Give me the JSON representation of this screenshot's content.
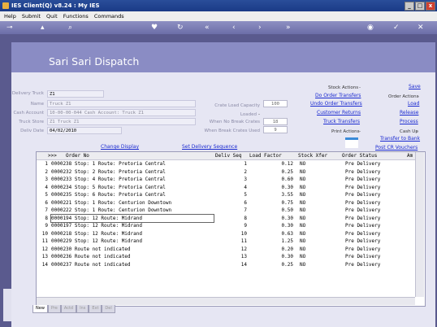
{
  "window": {
    "title": "IES Client(Q) v8.24 : My IES",
    "controls": [
      "_",
      "□",
      "x"
    ]
  },
  "menu": [
    "Help",
    "Submit",
    "Quit",
    "Functions",
    "Commands"
  ],
  "toolbar": {
    "icons": [
      "key-icon",
      "lock-icon",
      "search-icon",
      "heart-icon",
      "refresh-icon",
      "first-icon",
      "prev-icon",
      "next-icon",
      "last-icon",
      "stop-icon",
      "ok-icon",
      "cancel-icon"
    ]
  },
  "page": {
    "title": "Sari Sari Dispatch"
  },
  "form": {
    "delivery_truck": {
      "label": "Delivery Truck",
      "value": "Z1"
    },
    "name": {
      "label": "Name",
      "value": "Truck Z1"
    },
    "cash_account": {
      "label": "Cash Account",
      "value": "10-00-00-044 Cash Account: Truck Z1"
    },
    "truck_store": {
      "label": "Truck Store",
      "value": "Z1 Truck Z1"
    },
    "deliv_date": {
      "label": "Deliv Date",
      "value": "04/02/2010"
    },
    "crate_load_capacity": {
      "label": "Crate Load Capacity",
      "value": "100"
    },
    "loaded": {
      "label": "Loaded",
      "value": "-"
    },
    "when_no_break_crates": {
      "label": "When No Break Crates",
      "value": "18"
    },
    "when_break_crates_used": {
      "label": "When Break Crates Used",
      "value": "9"
    }
  },
  "stock_actions": {
    "label": "Stock Actions",
    "marker": "-",
    "links": [
      "Do Order Transfers",
      "Undo Order Transfers",
      "Customer Returns",
      "Truck Transfers"
    ]
  },
  "print_actions": {
    "label": "Print Actions",
    "marker": "-"
  },
  "order_actions": {
    "label": "Order Actions",
    "marker": "-",
    "links": [
      "Save",
      "Load",
      "Release",
      "Process"
    ]
  },
  "cash_up": {
    "label": "Cash Up",
    "marker": "-",
    "links": [
      "Transfer to Bank",
      "Post CR Vouchers"
    ]
  },
  "links": {
    "change_display": "Change Display",
    "set_delivery_sequence": "Set Delivery Sequence"
  },
  "grid": {
    "headers": {
      "marker": ">>>",
      "order_no": "Order No",
      "deliv_seq": "Deliv Seq",
      "load_factor": "Load Factor",
      "stock_xfer": "Stock Xfer",
      "order_status": "Order Status",
      "trunc": "Am"
    },
    "rows": [
      {
        "n": "1",
        "order": "0000238 Stop: 1 Route: Pretoria Central",
        "seq": "1",
        "load": "0.12",
        "xfer": "NO",
        "status": "Pre Delivery"
      },
      {
        "n": "2",
        "order": "0000232 Stop: 2 Route: Pretoria Central",
        "seq": "2",
        "load": "0.25",
        "xfer": "NO",
        "status": "Pre Delivery"
      },
      {
        "n": "3",
        "order": "0000233 Stop: 4 Route: Pretoria Central",
        "seq": "3",
        "load": "0.60",
        "xfer": "NO",
        "status": "Pre Delivery"
      },
      {
        "n": "4",
        "order": "0000234 Stop: 5 Route: Pretoria Central",
        "seq": "4",
        "load": "0.30",
        "xfer": "NO",
        "status": "Pre Delivery"
      },
      {
        "n": "5",
        "order": "0000235 Stop: 6 Route: Pretoria Central",
        "seq": "5",
        "load": "3.55",
        "xfer": "NO",
        "status": "Pre Delivery"
      },
      {
        "n": "6",
        "order": "0000221 Stop: 1 Route: Centurion Downtown",
        "seq": "6",
        "load": "0.75",
        "xfer": "NO",
        "status": "Pre Delivery"
      },
      {
        "n": "7",
        "order": "0000222 Stop: 1 Route: Centurion Downtown",
        "seq": "7",
        "load": "0.50",
        "xfer": "NO",
        "status": "Pre Delivery"
      },
      {
        "n": "8",
        "order": "0000194 Stop: 12 Route: Midrand",
        "seq": "8",
        "load": "0.30",
        "xfer": "NO",
        "status": "Pre Delivery"
      },
      {
        "n": "9",
        "order": "0000197 Stop: 12 Route: Midrand",
        "seq": "9",
        "load": "0.30",
        "xfer": "NO",
        "status": "Pre Delivery"
      },
      {
        "n": "10",
        "order": "0000218 Stop: 12 Route: Midrand",
        "seq": "10",
        "load": "0.63",
        "xfer": "NO",
        "status": "Pre Delivery"
      },
      {
        "n": "11",
        "order": "0000229 Stop: 12 Route: Midrand",
        "seq": "11",
        "load": "1.25",
        "xfer": "NO",
        "status": "Pre Delivery"
      },
      {
        "n": "12",
        "order": "0000230 Route not indicated",
        "seq": "12",
        "load": "0.20",
        "xfer": "NO",
        "status": "Pre Delivery"
      },
      {
        "n": "13",
        "order": "0000236 Route not indicated",
        "seq": "13",
        "load": "0.30",
        "xfer": "NO",
        "status": "Pre Delivery"
      },
      {
        "n": "14",
        "order": "0000237 Route not indicated",
        "seq": "14",
        "load": "0.25",
        "xfer": "NO",
        "status": "Pre Delivery"
      }
    ],
    "selected_row": 8
  },
  "tabs": [
    "New",
    "Pre",
    "Actd",
    "Ins",
    "Ext",
    "Del"
  ],
  "colors": {
    "titlebar": "#1a3a86",
    "frame": "#5a5a8e",
    "header": "#8a8cc4",
    "panel": "#e6e6f3",
    "link": "#1a2ad0"
  }
}
